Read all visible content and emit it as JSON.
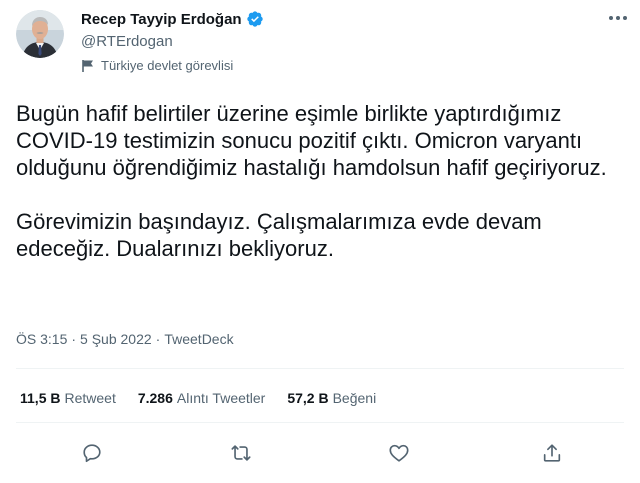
{
  "author": {
    "display_name": "Recep Tayyip Erdoğan",
    "handle": "@RTErdogan",
    "label": "Türkiye devlet görevlisi",
    "avatar_icon": "profile-photo",
    "verified_icon": "verified-badge-icon",
    "verified_color": "#1d9bf0"
  },
  "tweet": {
    "text": "Bugün hafif belirtiler üzerine eşimle birlikte yaptırdığımız COVID-19 testimizin sonucu pozitif çıktı. Omicron varyantı olduğunu öğrendiğimiz hastalığı hamdolsun hafif geçiriyoruz.\n\nGörevimizin başındayız. Çalışmalarımıza evde devam edeceğiz. Dualarınızı bekliyoruz.",
    "time": "ÖS 3:15",
    "separator1": "·",
    "date": "5 Şub 2022",
    "separator2": "·",
    "source": "TweetDeck"
  },
  "stats": [
    {
      "count": "11,5 B",
      "label": "Retweet"
    },
    {
      "count": "7.286",
      "label": "Alıntı Tweetler"
    },
    {
      "count": "57,2 B",
      "label": "Beğeni"
    }
  ],
  "actions": {
    "reply_icon": "reply-icon",
    "retweet_icon": "retweet-icon",
    "like_icon": "like-icon",
    "share_icon": "share-icon",
    "more_icon": "more-icon",
    "icon_color": "#536471"
  }
}
